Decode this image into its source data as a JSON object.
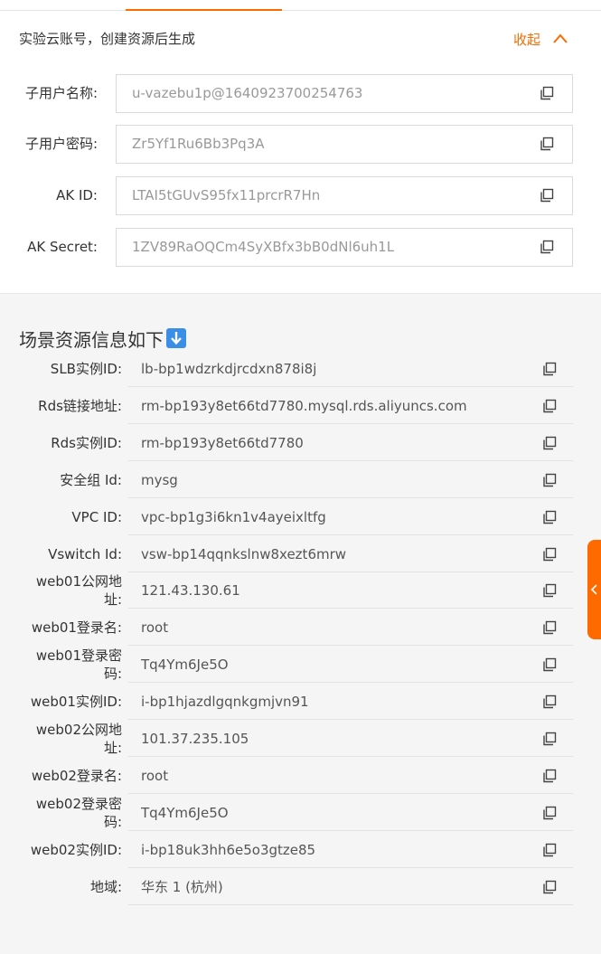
{
  "account": {
    "title": "实验云账号，创建资源后生成",
    "collapse_label": "收起",
    "fields": [
      {
        "label": "子用户名称:",
        "value": "u-vazebu1p@1640923700254763"
      },
      {
        "label": "子用户密码:",
        "value": "Zr5Yf1Ru6Bb3Pq3A"
      },
      {
        "label": "AK ID:",
        "value": "LTAI5tGUvS95fx11prcrR7Hn"
      },
      {
        "label": "AK Secret:",
        "value": "1ZV89RaOQCm4SyXBfx3bB0dNl6uh1L"
      }
    ]
  },
  "scene": {
    "title": "场景资源信息如下",
    "resources": [
      {
        "label": "SLB实例ID:",
        "value": "lb-bp1wdzrkdjrcdxn878i8j"
      },
      {
        "label": "Rds链接地址:",
        "value": "rm-bp193y8et66td7780.mysql.rds.aliyuncs.com"
      },
      {
        "label": "Rds实例ID:",
        "value": "rm-bp193y8et66td7780"
      },
      {
        "label": "安全组 Id:",
        "value": "mysg"
      },
      {
        "label": "VPC ID:",
        "value": "vpc-bp1g3i6kn1v4ayeixltfg"
      },
      {
        "label": "Vswitch Id:",
        "value": "vsw-bp14qqnkslnw8xezt6mrw"
      },
      {
        "label": "web01公网地址:",
        "label_l1": "web01公网地",
        "label_l2": "址:",
        "value": "121.43.130.61"
      },
      {
        "label": "web01登录名:",
        "value": "root"
      },
      {
        "label": "web01登录密码:",
        "label_l1": "web01登录密",
        "label_l2": "码:",
        "value": "Tq4Ym6Je5O"
      },
      {
        "label": "web01实例ID:",
        "value": "i-bp1hjazdlgqnkgmjvn91"
      },
      {
        "label": "web02公网地址:",
        "label_l1": "web02公网地",
        "label_l2": "址:",
        "value": "101.37.235.105"
      },
      {
        "label": "web02登录名:",
        "value": "root"
      },
      {
        "label": "web02登录密码:",
        "label_l1": "web02登录密",
        "label_l2": "码:",
        "value": "Tq4Ym6Je5O"
      },
      {
        "label": "web02实例ID:",
        "value": "i-bp18uk3hh6e5o3gtze85"
      },
      {
        "label": "地域:",
        "value": "华东 1 (杭州)"
      }
    ]
  },
  "colors": {
    "accent": "#ff6a00",
    "emoji_blue": "#3a8ee6"
  },
  "icons": {
    "copy": "copy-icon",
    "collapse": "chevron-up-icon",
    "down_arrow": "down-arrow-emoji-icon",
    "side_handle": "chevron-left-icon"
  }
}
